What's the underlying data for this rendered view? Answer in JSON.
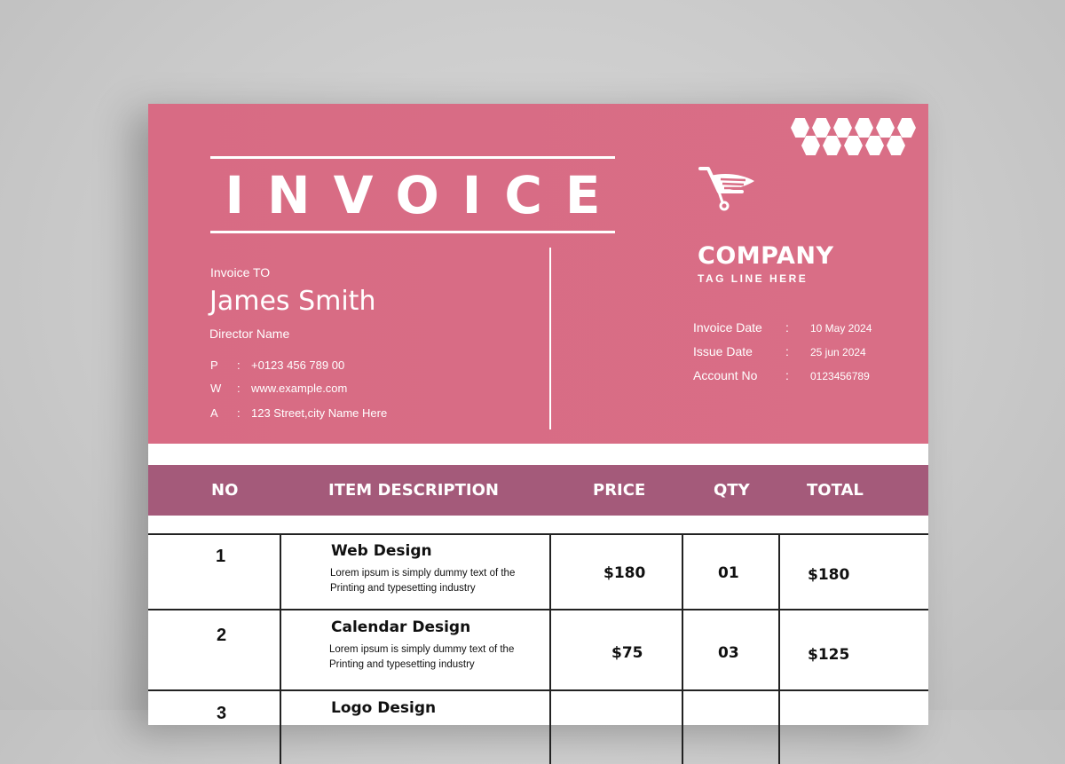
{
  "invoice": {
    "title": "INVOICE",
    "to_label": "Invoice TO",
    "client_name": "James Smith",
    "client_title": "Director Name",
    "contacts": [
      {
        "key": "P",
        "sep": ":",
        "value": "+0123 456 789 00"
      },
      {
        "key": "W",
        "sep": ":",
        "value": "www.example.com"
      },
      {
        "key": "A",
        "sep": ":",
        "value": "123 Street,city Name Here"
      }
    ]
  },
  "company": {
    "name": "COMPANY",
    "tagline": "TAG LINE HERE",
    "logo_icon": "shopping-cart-icon",
    "meta": [
      {
        "label": "Invoice Date",
        "sep": ":",
        "value": "10 May 2024"
      },
      {
        "label": "Issue Date",
        "sep": ":",
        "value": "25 jun 2024"
      },
      {
        "label": "Account No",
        "sep": ":",
        "value": "0123456789"
      }
    ]
  },
  "table": {
    "headers": {
      "no": "NO",
      "description": "ITEM DESCRIPTION",
      "price": "PRICE",
      "qty": "QTY",
      "total": "TOTAL"
    },
    "rows": [
      {
        "no": "1",
        "name": "Web Design",
        "desc": "Lorem ipsum is simply dummy text of the Printing and typesetting industry",
        "price": "$180",
        "qty": "01",
        "total": "$180"
      },
      {
        "no": "2",
        "name": "Calendar Design",
        "desc": "Lorem ipsum is simply dummy text of the Printing and typesetting industry",
        "price": "$75",
        "qty": "03",
        "total": "$125"
      },
      {
        "no": "3",
        "name": "Logo Design",
        "desc": "",
        "price": "",
        "qty": "",
        "total": ""
      }
    ]
  },
  "colors": {
    "header_pink": "#d96e86",
    "table_header_mauve": "#a45a7a",
    "sheet": "#ffffff",
    "background": "#c9c9c9"
  }
}
